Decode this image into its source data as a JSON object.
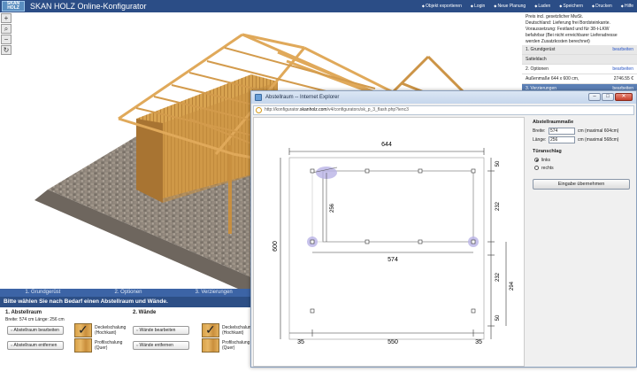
{
  "app": {
    "logo": "SKAN HOLZ",
    "title": "SKAN HOLZ Online-Konfigurator"
  },
  "topnav": [
    "Objekt exportieren",
    "Login",
    "Neue Planung",
    "Laden",
    "Speichern",
    "Drucken",
    "Hilfe"
  ],
  "toolbar": [
    "zoom-in-icon",
    "zoom-fit-icon",
    "zoom-out-icon",
    "rotate-icon"
  ],
  "summary": {
    "note_lines": [
      "Preis incl. gesetzlicher MwSt.",
      "Deutschland: Lieferung frei Bordsteinkante.",
      "Voraussetzung: Festland und für 38-t-LKW",
      "befahrbar (Bei nicht erreichbarer Lieferadresse",
      "werden Zusatzkosten berechnet)"
    ],
    "rows": [
      {
        "label": "1. Grundgerüst",
        "value": "bearbeiten",
        "style": "grey"
      },
      {
        "label": "Satteldach",
        "value": "",
        "style": ""
      },
      {
        "label": "2. Optionen",
        "value": "bearbeiten",
        "style": ""
      },
      {
        "label": "Außenmaße 644 x 600 cm,",
        "value": "2746.55 €",
        "style": ""
      },
      {
        "label": "3. Verzierungen",
        "value": "bearbeiten",
        "style": "blue"
      }
    ]
  },
  "steps": [
    "1. Grundgerüst",
    "2. Optionen",
    "3. Verzierungen"
  ],
  "instruction": "Bitte wählen Sie nach Bedarf einen Abstellraum und Wände.",
  "abstellraum": {
    "heading": "1. Abstellraum",
    "dims": "Breite: 574 cm Länge: 256 cm",
    "edit": "Abstellraum bearbeiten",
    "remove": "Abstellraum entfernen",
    "opt1": "Deckelschalung (Hochkant)",
    "opt2": "Profilschalung (Quer)"
  },
  "waende": {
    "heading": "2. Wände",
    "edit": "Wände bearbeiten",
    "remove": "Wände entfernen",
    "opt1": "Deckelschalung (Hochkant)",
    "opt2": "Profilschalung (Quer)"
  },
  "popup": {
    "title": "Abstellraum -- Internet Explorer",
    "url_prefix": "http://konfigurator.",
    "url_domain": "skanholz.com",
    "url_suffix": "/v4/configurators/sk_p_3_flash.php?ienc3",
    "form": {
      "heading": "Abstellraummaße",
      "breite_label": "Breite:",
      "breite_value": "574",
      "breite_unit": "cm (maximal 604cm)",
      "laenge_label": "Länge:",
      "laenge_value": "256",
      "laenge_unit": "cm (maximal 568cm)",
      "door_heading": "Türanschlag",
      "door_left": "links",
      "door_right": "rechts",
      "apply": "Eingabe übernehmen"
    },
    "plan": {
      "top_width": "644",
      "left_height": "600",
      "room_length": "256",
      "room_width": "574",
      "right_top": "50",
      "right_mid": "232",
      "right_low": "232",
      "right_bottom": "50",
      "right_total": "294",
      "bottom_left": "35",
      "bottom_mid": "550",
      "bottom_right": "35"
    }
  }
}
